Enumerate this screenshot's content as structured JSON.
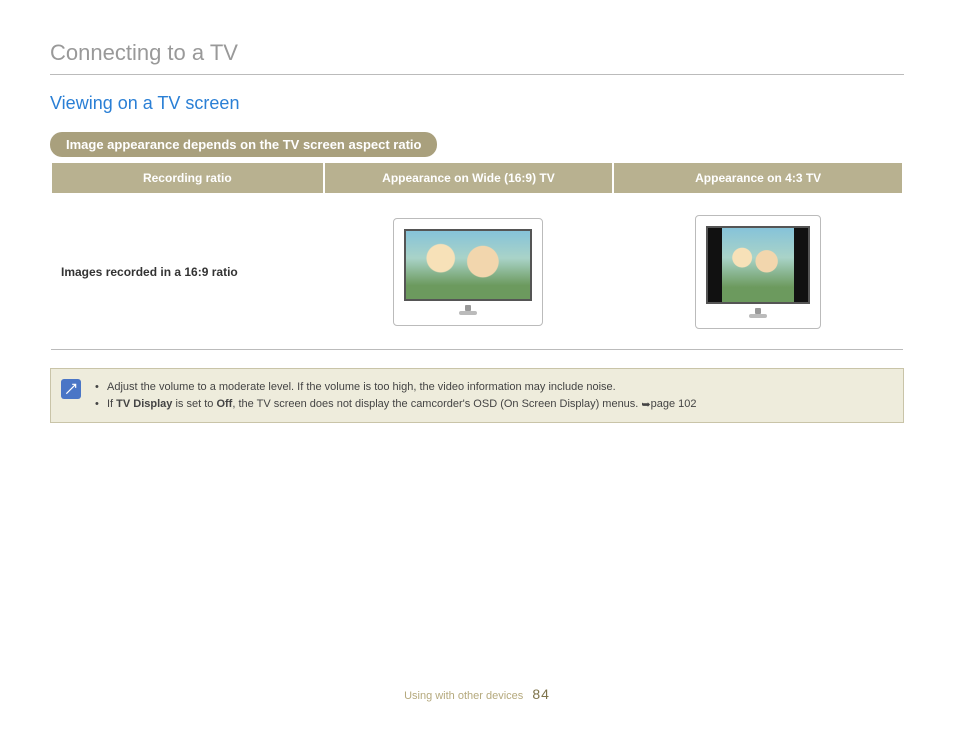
{
  "page": {
    "title": "Connecting to a TV",
    "subtitle": "Viewing on a TV screen"
  },
  "pill": {
    "text": "Image appearance depends on the TV screen aspect ratio"
  },
  "table": {
    "headers": {
      "col1": "Recording ratio",
      "col2": "Appearance on Wide (16:9) TV",
      "col3": "Appearance on 4:3 TV"
    },
    "row1": {
      "label": "Images recorded in a 16:9 ratio"
    }
  },
  "notes": {
    "item1_text": "Adjust the volume to a moderate level. If the volume is too high, the video information may include noise.",
    "item2_prefix": "If ",
    "item2_bold1": "TV Display",
    "item2_mid": " is set to ",
    "item2_bold2": "Off",
    "item2_rest": ", the TV screen does not display the camcorder's OSD (On Screen Display) menus. ",
    "item2_pageref": "page 102"
  },
  "footer": {
    "section": "Using with other devices",
    "page_number": "84"
  }
}
